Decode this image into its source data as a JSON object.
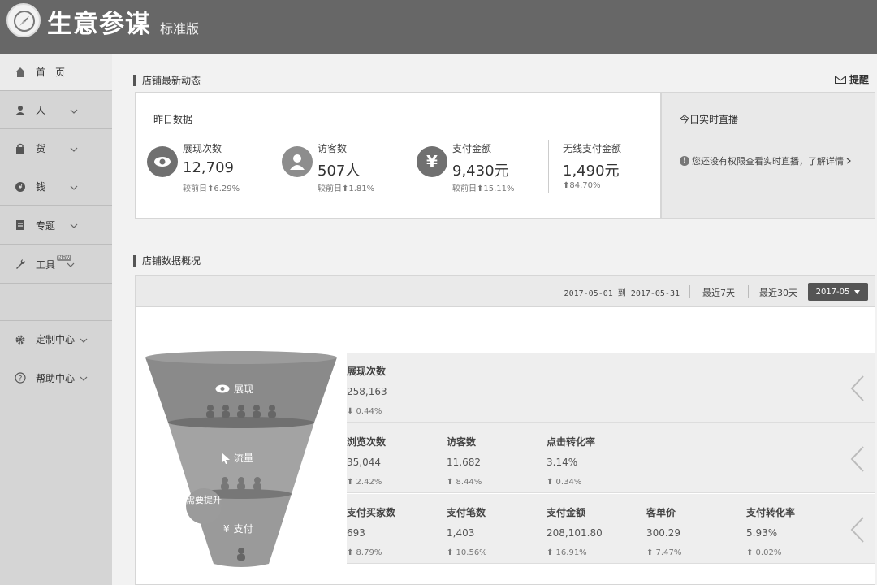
{
  "header": {
    "title": "生意参谋",
    "edition": "标准版"
  },
  "sidebar": {
    "items": [
      {
        "label": "首　页"
      },
      {
        "label": "人"
      },
      {
        "label": "货"
      },
      {
        "label": "钱"
      },
      {
        "label": "专题"
      },
      {
        "label": "工具",
        "badge": "NEW"
      },
      {
        "label": "定制中心"
      },
      {
        "label": "帮助中心"
      }
    ]
  },
  "latest": {
    "section_title": "店铺最新动态",
    "remind_label": "提醒",
    "yesterday_label": "昨日数据",
    "metrics": [
      {
        "label": "展现次数",
        "value": "12,709",
        "compare": "较前日⬆6.29%"
      },
      {
        "label": "访客数",
        "value": "507人",
        "compare": "较前日⬆1.81%"
      },
      {
        "label": "支付金额",
        "value": "9,430元",
        "compare": "较前日⬆15.11%"
      },
      {
        "label": "无线支付金额",
        "value": "1,490元",
        "compare": "⬆84.70%"
      }
    ],
    "live_title": "今日实时直播",
    "live_note": "您还没有权限查看实时直播，了解详情"
  },
  "overview": {
    "section_title": "店铺数据概况",
    "date_range": "2017-05-01 到 2017-05-31",
    "last7": "最近7天",
    "last30": "最近30天",
    "month": "2017-05",
    "stages": [
      {
        "label": "展现",
        "cells": [
          {
            "label": "展现次数",
            "value": "258,163",
            "change": "⬇ 0.44%"
          }
        ]
      },
      {
        "label": "流量",
        "cells": [
          {
            "label": "浏览次数",
            "value": "35,044",
            "change": "⬆ 2.42%"
          },
          {
            "label": "访客数",
            "value": "11,682",
            "change": "⬆ 8.44%"
          },
          {
            "label": "点击转化率",
            "value": "3.14%",
            "change": "⬆ 0.34%"
          }
        ]
      },
      {
        "label": "支付",
        "cells": [
          {
            "label": "支付买家数",
            "value": "693",
            "change": "⬆ 8.79%"
          },
          {
            "label": "支付笔数",
            "value": "1,403",
            "change": "⬆ 10.56%"
          },
          {
            "label": "支付金额",
            "value": "208,101.80",
            "change": "⬆ 16.91%"
          },
          {
            "label": "客单价",
            "value": "300.29",
            "change": "⬆ 7.47%"
          },
          {
            "label": "支付转化率",
            "value": "5.93%",
            "change": "⬆ 0.02%"
          }
        ]
      }
    ],
    "need_improve": "需要提升"
  }
}
